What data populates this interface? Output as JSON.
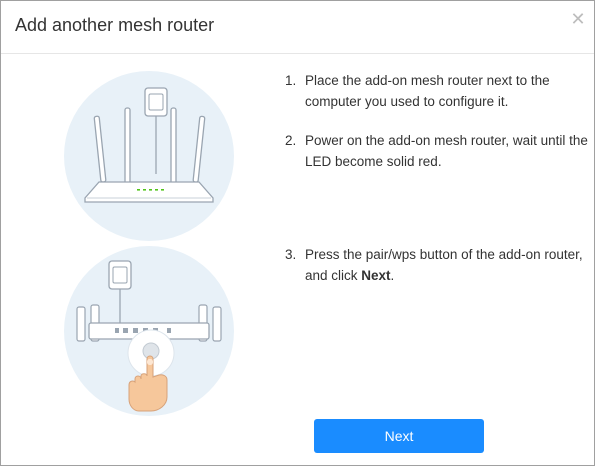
{
  "dialog": {
    "title": "Add another mesh router",
    "close_icon": "close-icon"
  },
  "steps": [
    {
      "num": "1.",
      "text": "Place the add-on mesh router next to the computer you used to configure it."
    },
    {
      "num": "2.",
      "text": "Power on the add-on mesh router, wait until the LED become solid red."
    },
    {
      "num": "3.",
      "text_before": "Press the pair/wps button of the add-on router, and click ",
      "text_bold": "Next",
      "text_after": "."
    }
  ],
  "illustrations": [
    {
      "icon": "router-with-power-adapter-icon"
    },
    {
      "icon": "press-pair-button-icon"
    }
  ],
  "footer": {
    "next_label": "Next"
  },
  "colors": {
    "accent": "#1a8cff",
    "illustration_bg": "#e8f1f8",
    "led": "#52c41a"
  }
}
